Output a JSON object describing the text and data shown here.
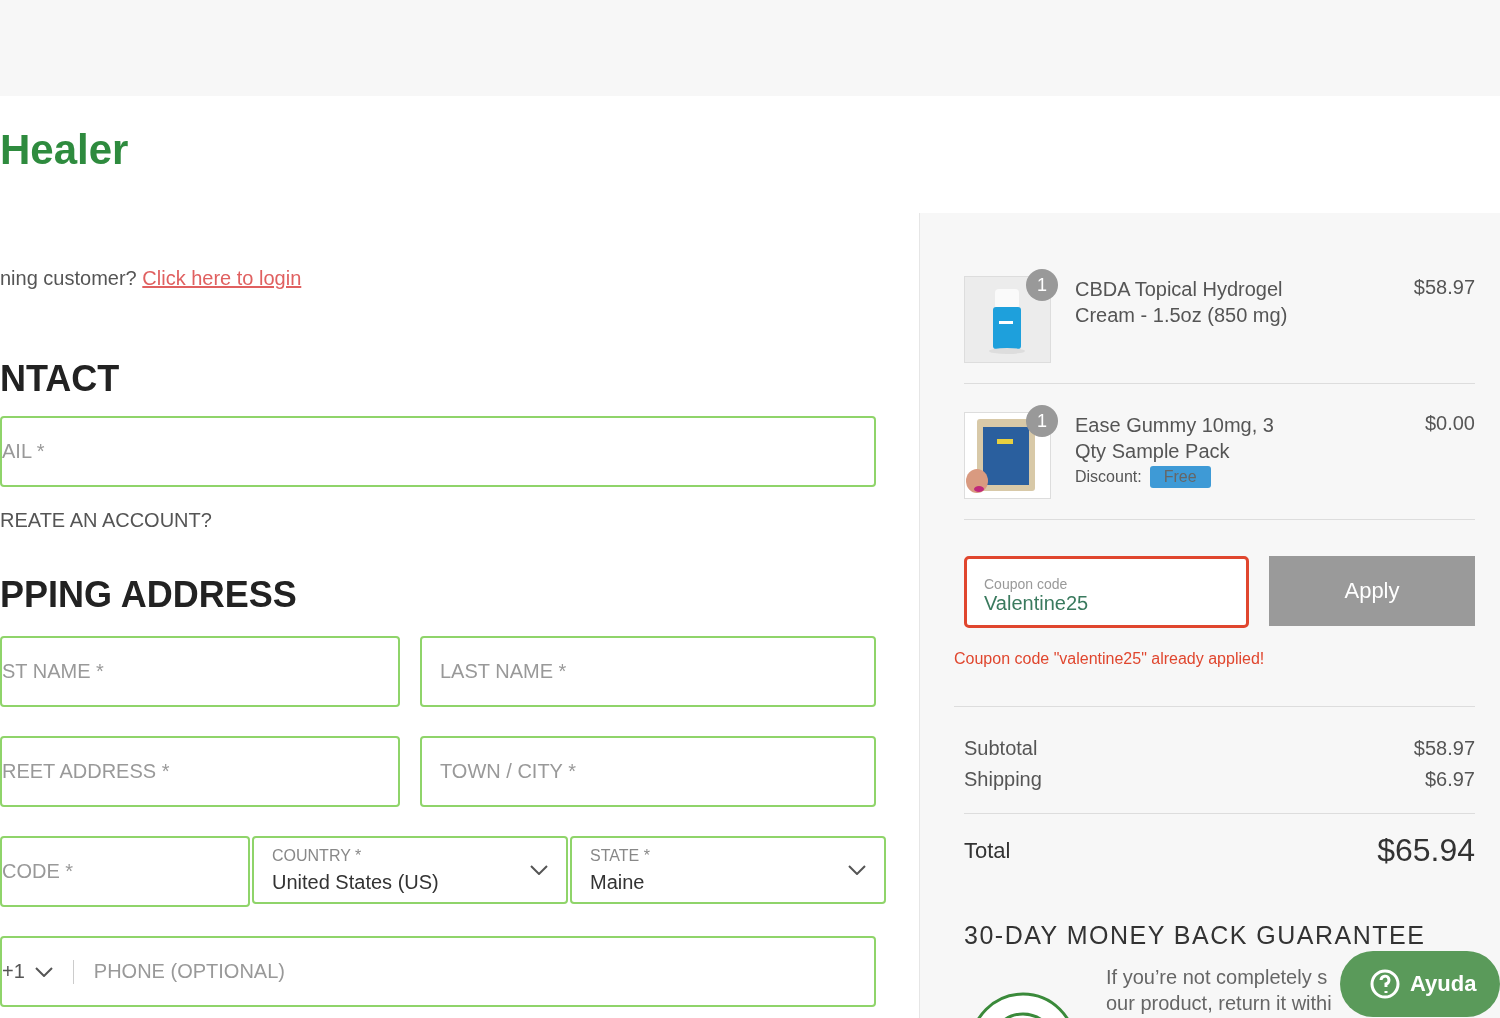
{
  "brand": "Healer",
  "login_prompt": {
    "text": "ning customer?",
    "link": "Click here to login"
  },
  "contact": {
    "heading": "NTACT",
    "email": {
      "placeholder": "AIL *"
    },
    "create_account": {
      "label": "REATE AN ACCOUNT?"
    }
  },
  "shipping": {
    "heading": "PPING ADDRESS",
    "first_name": {
      "placeholder": "ST NAME *"
    },
    "last_name": {
      "placeholder": "LAST NAME *"
    },
    "street": {
      "placeholder": "REET ADDRESS *"
    },
    "town": {
      "placeholder": "TOWN / CITY *"
    },
    "zip": {
      "placeholder": "CODE *"
    },
    "country": {
      "label": "COUNTRY *",
      "value": "United States (US)"
    },
    "state": {
      "label": "STATE *",
      "value": "Maine"
    },
    "phone": {
      "code": "+1",
      "placeholder": "PHONE (OPTIONAL)"
    }
  },
  "cart": {
    "items": [
      {
        "kind": "bottle",
        "quantity": "1",
        "name": "CBDA Topical Hydrogel Cream - 1.5oz (850 mg)",
        "price": "$58.97"
      },
      {
        "kind": "pack",
        "quantity": "1",
        "name": "Ease Gummy 10mg, 3 Qty Sample Pack",
        "price": "$0.00",
        "discount_label": "Discount:",
        "discount": "Free"
      }
    ],
    "coupon": {
      "placeholder": "Coupon code",
      "value": "Valentine25",
      "error": true,
      "button": "Apply",
      "message": "Coupon code \"valentine25\" already applied!"
    },
    "totals": [
      {
        "label": "Subtotal",
        "value": "$58.97"
      },
      {
        "label": "Shipping",
        "value": "$6.97"
      }
    ],
    "total": {
      "label": "Total",
      "value": "$65.94"
    },
    "guarantee": {
      "heading": "30-DAY MONEY BACK GUARANTEE",
      "lines": [
        "If you’re not completely s",
        "our product, return it withi"
      ]
    }
  },
  "help_button": "Ayuda"
}
